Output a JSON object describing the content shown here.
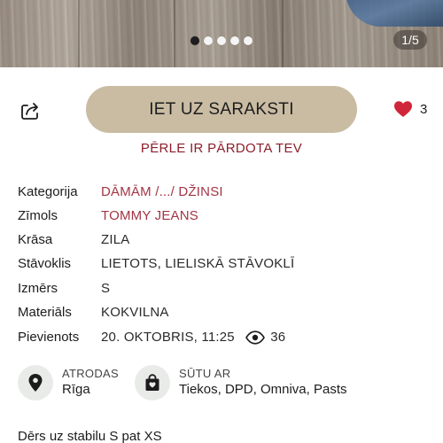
{
  "gallery": {
    "counter": "1/5",
    "dots_total": 5,
    "active_dot": 0
  },
  "actions": {
    "share_icon": "share-icon",
    "primary_label": "IET UZ SARAKSTI",
    "likes_icon": "heart-icon",
    "likes_count": "3",
    "sold_note": "PĒRLE IR PĀRDOTA TEV"
  },
  "attributes": [
    {
      "key": "Kategorija",
      "value": "DĀMĀM /.../ DŽINSI",
      "link": true
    },
    {
      "key": "Zīmols",
      "value": "TOMMY JEANS",
      "link": true
    },
    {
      "key": "Krāsa",
      "value": "ZILA",
      "link": false
    },
    {
      "key": "Stāvoklis",
      "value": "LIETOTS, LIELISKĀ STĀVOKLĪ",
      "link": false
    },
    {
      "key": "Izmērs",
      "value": "S",
      "link": false
    },
    {
      "key": "Materiāls",
      "value": "KOKVILNA",
      "link": false
    },
    {
      "key": "Pievienots",
      "value": "20. OKTOBRIS, 11:25",
      "link": false
    }
  ],
  "views": {
    "icon": "eye-icon",
    "count": "36"
  },
  "location": {
    "icon": "location-pin-icon",
    "label": "ATRODAS",
    "value": "Rīga"
  },
  "shipping": {
    "icon": "shopping-bag-icon",
    "label": "SŪTU AR",
    "value": "Tiekos, DPD, Omniva, Pasts"
  },
  "description": "Dērs uz stabilu S pat XS",
  "colors": {
    "accent_button": "#c9bca3",
    "link": "#a23545",
    "sold_note": "#8c1e2a",
    "heart": "#d0263a"
  }
}
